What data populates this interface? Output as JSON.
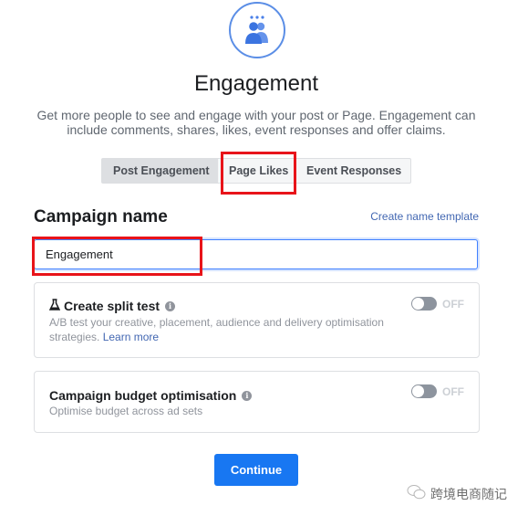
{
  "header": {
    "icon": "engagement-people-icon",
    "title": "Engagement",
    "subtitle": "Get more people to see and engage with your post or Page. Engagement can include comments, shares, likes, event responses and offer claims."
  },
  "tabs": [
    {
      "label": "Post Engagement",
      "active": true
    },
    {
      "label": "Page Likes",
      "active": false,
      "highlighted": true
    },
    {
      "label": "Event Responses",
      "active": false
    }
  ],
  "campaign_name": {
    "label": "Campaign name",
    "template_link": "Create name template",
    "value": "Engagement"
  },
  "split_test": {
    "icon": "flask-icon",
    "title": "Create split test",
    "description": "A/B test your creative, placement, audience and delivery optimisation strategies.",
    "learn_more": "Learn more",
    "toggle_state": "OFF"
  },
  "budget_optimisation": {
    "title": "Campaign budget optimisation",
    "description": "Optimise budget across ad sets",
    "toggle_state": "OFF"
  },
  "actions": {
    "continue_label": "Continue"
  },
  "watermark": {
    "text": "跨境电商随记"
  },
  "colors": {
    "accent": "#1877f2",
    "highlight": "#e8141a",
    "link": "#4267b2"
  }
}
